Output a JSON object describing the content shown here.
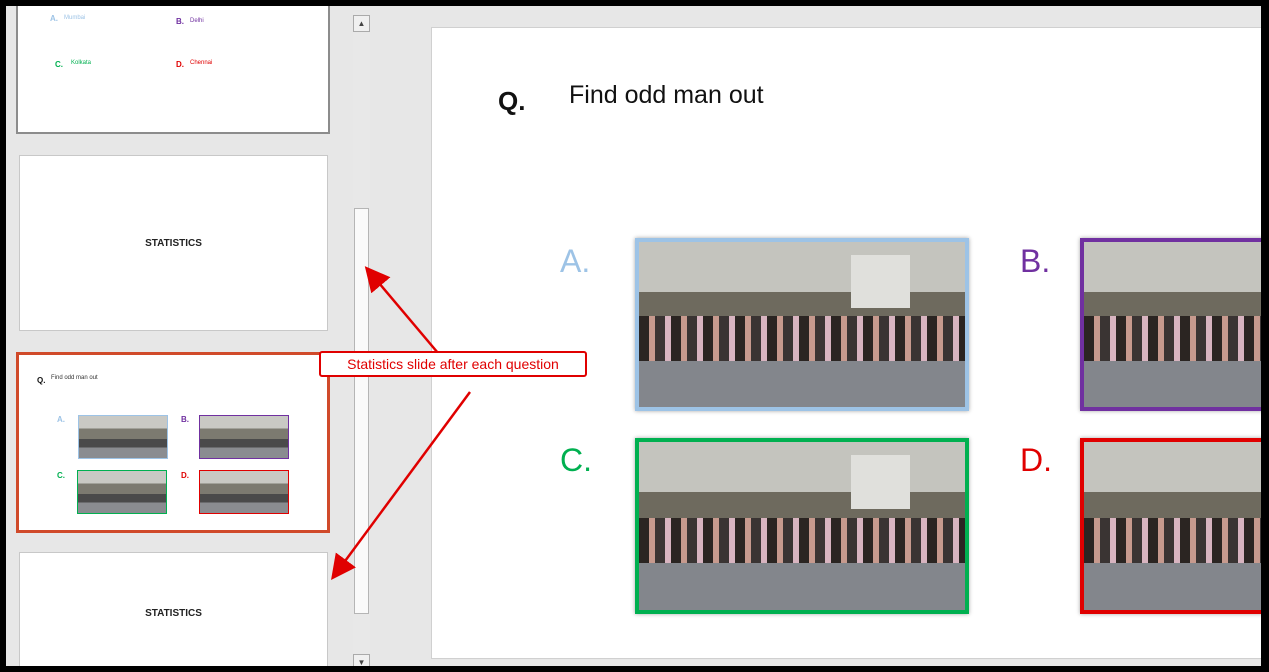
{
  "thumbnails": {
    "slide1": {
      "options": [
        {
          "letter": "A.",
          "text": "Mumbai",
          "color": "#9dc3e6"
        },
        {
          "letter": "B.",
          "text": "Delhi",
          "color": "#7030a0"
        },
        {
          "letter": "C.",
          "text": "Kolkata",
          "color": "#00b050"
        },
        {
          "letter": "D.",
          "text": "Chennai",
          "color": "#e00000"
        }
      ]
    },
    "slide2": {
      "title": "STATISTICS"
    },
    "slide3": {
      "q": "Q.",
      "question": "Find odd man out",
      "letters": [
        "A.",
        "B.",
        "C.",
        "D."
      ]
    },
    "slide4": {
      "title": "STATISTICS"
    }
  },
  "main_slide": {
    "q": "Q.",
    "question": "Find odd man out",
    "options": [
      {
        "letter": "A.",
        "color": "#9dc3e6"
      },
      {
        "letter": "B.",
        "color": "#7030a0"
      },
      {
        "letter": "C.",
        "color": "#00b050"
      },
      {
        "letter": "D.",
        "color": "#e00000"
      }
    ]
  },
  "annotation": {
    "text": "Statistics slide after each question",
    "color": "#e00000"
  },
  "icons": {
    "scroll_up": "chevron-up-icon",
    "scroll_down": "chevron-down-icon"
  }
}
